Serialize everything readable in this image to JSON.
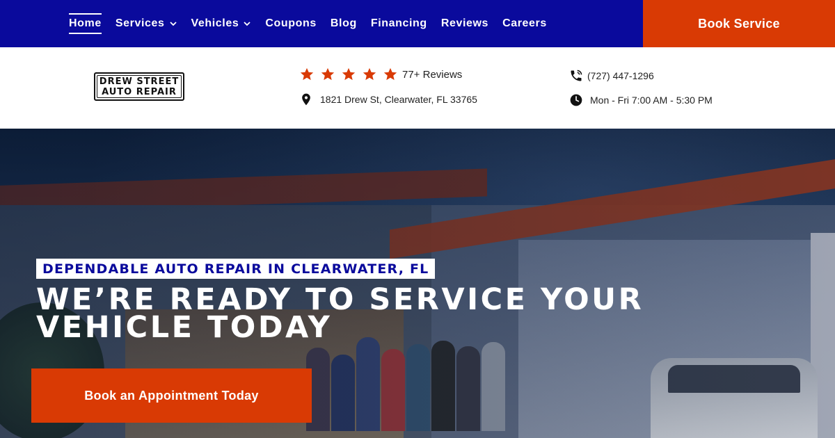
{
  "nav": {
    "items": [
      {
        "label": "Home",
        "active": true,
        "dropdown": false
      },
      {
        "label": "Services",
        "active": false,
        "dropdown": true
      },
      {
        "label": "Vehicles",
        "active": false,
        "dropdown": true
      },
      {
        "label": "Coupons",
        "active": false,
        "dropdown": false
      },
      {
        "label": "Blog",
        "active": false,
        "dropdown": false
      },
      {
        "label": "Financing",
        "active": false,
        "dropdown": false
      },
      {
        "label": "Reviews",
        "active": false,
        "dropdown": false
      },
      {
        "label": "Careers",
        "active": false,
        "dropdown": false
      }
    ],
    "book_label": "Book Service"
  },
  "logo": {
    "line1": "DREW STREET",
    "line2": "AUTO REPAIR"
  },
  "info": {
    "rating_stars": 5,
    "reviews": "77+ Reviews",
    "address": "1821 Drew St, Clearwater, FL 33765",
    "phone": "(727) 447-1296",
    "hours": "Mon - Fri 7:00 AM - 5:30 PM"
  },
  "hero": {
    "tagline": "DEPENDABLE AUTO REPAIR IN CLEARWATER, FL",
    "headline": "WE’RE READY TO SERVICE YOUR VEHICLE TODAY",
    "cta_label": "Book an Appointment Today"
  },
  "colors": {
    "nav_bg": "#0a0a9c",
    "accent": "#d93a04",
    "star": "#d93a04"
  },
  "icons": {
    "chevron": "chevron-down-icon",
    "star": "star-icon",
    "pin": "map-pin-icon",
    "phone": "phone-icon",
    "clock": "clock-icon"
  }
}
